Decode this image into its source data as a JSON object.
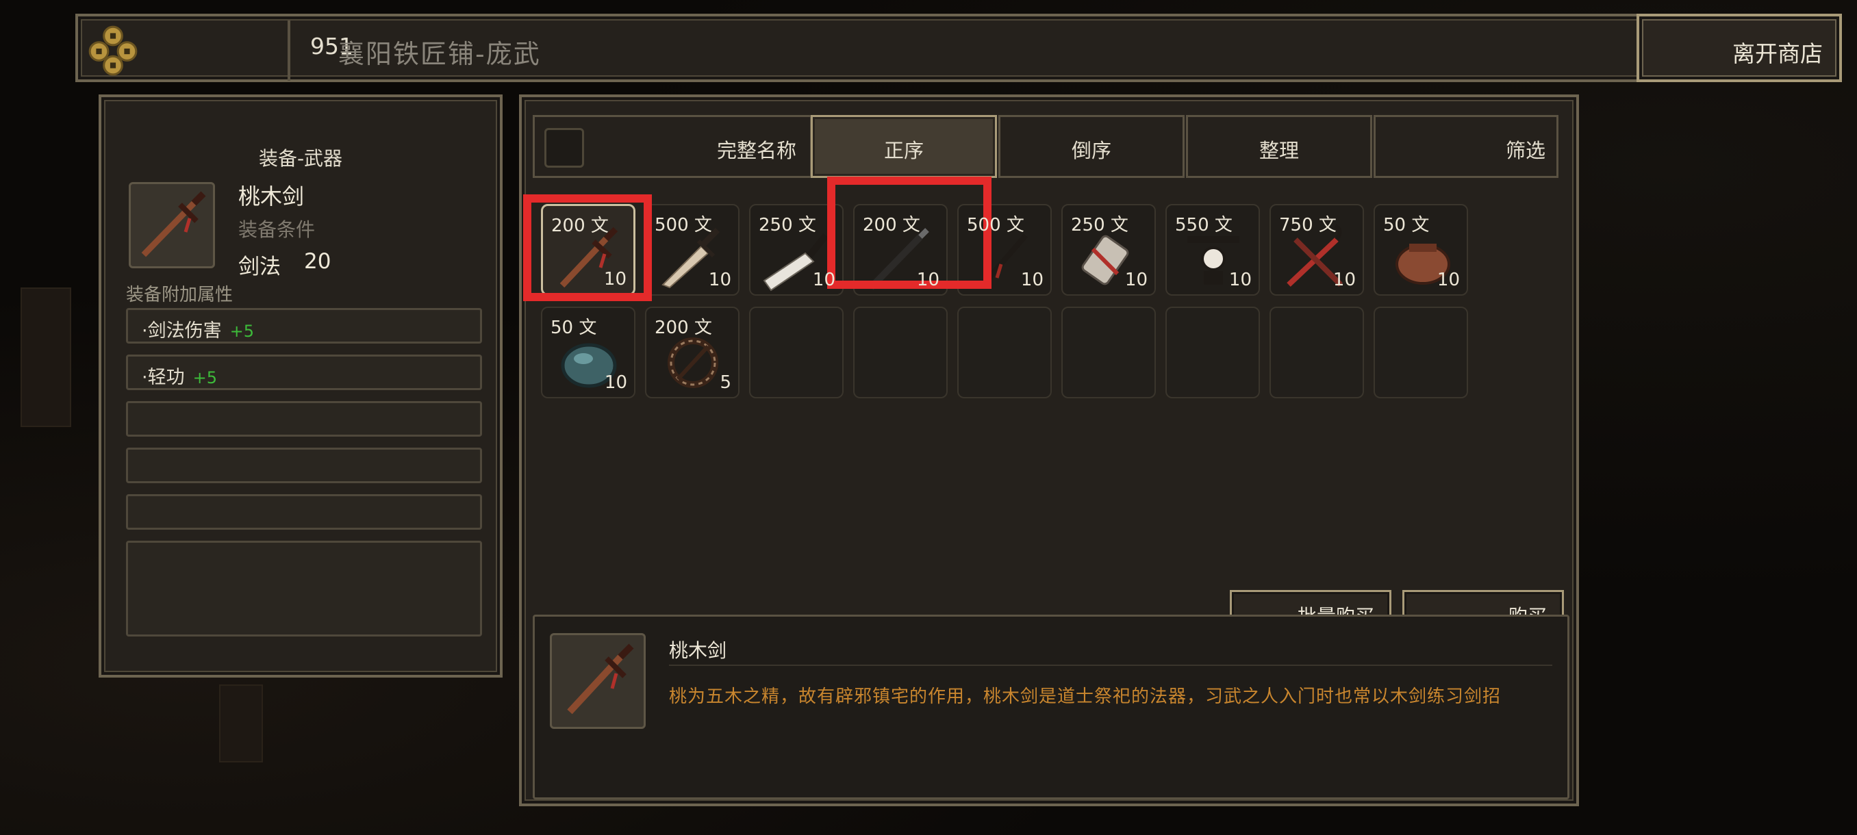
{
  "header": {
    "money": "951",
    "shop_title": "襄阳铁匠铺-庞武",
    "leave_label": "离开商店"
  },
  "equip": {
    "category": "装备-武器",
    "name": "桃木剑",
    "requirement_label": "装备条件",
    "requirement_skill": "剑法",
    "requirement_value": "20",
    "attr_label": "装备附加属性",
    "attrs": [
      {
        "name": "·剑法伤害",
        "bonus": "+5"
      },
      {
        "name": "·轻功",
        "bonus": "+5"
      }
    ]
  },
  "tabs": [
    {
      "label": "完整名称"
    },
    {
      "label": "正序"
    },
    {
      "label": "倒序"
    },
    {
      "label": "整理"
    },
    {
      "label": "筛选"
    }
  ],
  "items": [
    {
      "price": "200 文",
      "qty": "10",
      "icon": "peach-wood-sword-icon"
    },
    {
      "price": "500 文",
      "qty": "10",
      "icon": "dagger-icon"
    },
    {
      "price": "250 文",
      "qty": "10",
      "icon": "broad-blade-icon"
    },
    {
      "price": "200 文",
      "qty": "10",
      "icon": "iron-rod-sword-icon"
    },
    {
      "price": "500 文",
      "qty": "10",
      "icon": "thin-sword-icon"
    },
    {
      "price": "250 文",
      "qty": "10",
      "icon": "gauntlet-icon"
    },
    {
      "price": "550 文",
      "qty": "10",
      "icon": "claw-weapon-icon"
    },
    {
      "price": "750 文",
      "qty": "10",
      "icon": "crossed-hooks-icon"
    },
    {
      "price": "50 文",
      "qty": "10",
      "icon": "leather-pouch-icon"
    },
    {
      "price": "50 文",
      "qty": "10",
      "icon": "stone-ore-icon"
    },
    {
      "price": "200 文",
      "qty": "5",
      "icon": "rope-coil-icon"
    }
  ],
  "actions": {
    "bulk_buy": "批量购买",
    "buy": "购买"
  },
  "description": {
    "name": "桃木剑",
    "text": "桃为五木之精，故有辟邪镇宅的作用，桃木剑是道士祭祀的法器，习武之人入门时也常以木剑练习剑招"
  },
  "colors": {
    "accent_border": "#a99b78",
    "highlight_red": "#e42a2a",
    "bonus_green": "#3dbb3a",
    "desc_orange": "#c9862e"
  }
}
